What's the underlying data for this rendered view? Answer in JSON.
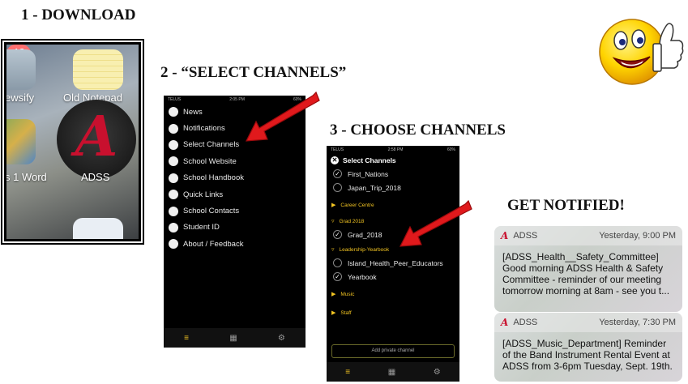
{
  "steps": {
    "step1": "1 - DOWNLOAD",
    "step2": "2 - “SELECT CHANNELS”",
    "step3": "3 - CHOOSE CHANNELS",
    "step4": "GET NOTIFIED!"
  },
  "home_screen": {
    "labels": [
      "ewsify",
      "Old Notepad",
      "ADSS",
      "s 1 Word"
    ],
    "badge_count": "49"
  },
  "menu_screen": {
    "status_carrier": "TELUS",
    "status_time": "2:05 PM",
    "status_battery": "60%",
    "items": [
      {
        "label": "News",
        "icon": "news-icon"
      },
      {
        "label": "Notifications",
        "icon": "bell-icon"
      },
      {
        "label": "Select Channels",
        "icon": "globe-icon"
      },
      {
        "label": "School Website",
        "icon": "web-icon"
      },
      {
        "label": "School Handbook",
        "icon": "book-icon"
      },
      {
        "label": "Quick Links",
        "icon": "rocket-icon"
      },
      {
        "label": "School Contacts",
        "icon": "phone-icon"
      },
      {
        "label": "Student ID",
        "icon": "person-icon"
      },
      {
        "label": "About / Feedback",
        "icon": "question-icon"
      }
    ]
  },
  "channels_screen": {
    "status_carrier": "TELUS",
    "status_time": "2:58 PM",
    "status_battery": "60%",
    "title": "Select Channels",
    "top_channels": [
      {
        "label": "First_Nations",
        "checked": true
      },
      {
        "label": "Japan_Trip_2018",
        "checked": false
      }
    ],
    "group_career": "Career Centre",
    "group_grad": "Grad 2018",
    "grad_channels": [
      {
        "label": "Grad_2018",
        "checked": true
      }
    ],
    "group_leadership": "Leadership-Yearbook",
    "leadership_channels": [
      {
        "label": "Island_Health_Peer_Educators",
        "checked": false
      },
      {
        "label": "Yearbook",
        "checked": true
      }
    ],
    "group_music": "Music",
    "group_staff": "Staff",
    "private_button": "Add private channel"
  },
  "notifications": [
    {
      "app": "ADSS",
      "time": "Yesterday, 9:00 PM",
      "body": "[ADSS_Health__Safety_Committee] Good morning ADSS Health & Safety Committee - reminder of our meeting tomorrow morning at 8am - see you t..."
    },
    {
      "app": "ADSS",
      "time": "Yesterday, 7:30 PM",
      "body": "[ADSS_Music_Department] Reminder of the Band Instrument Rental Event at ADSS from 3-6pm Tuesday, Sept. 19th."
    }
  ],
  "colors": {
    "accent_gold": "#f3c522",
    "arrow_red": "#e0191c",
    "adss_red": "#c8102e"
  }
}
